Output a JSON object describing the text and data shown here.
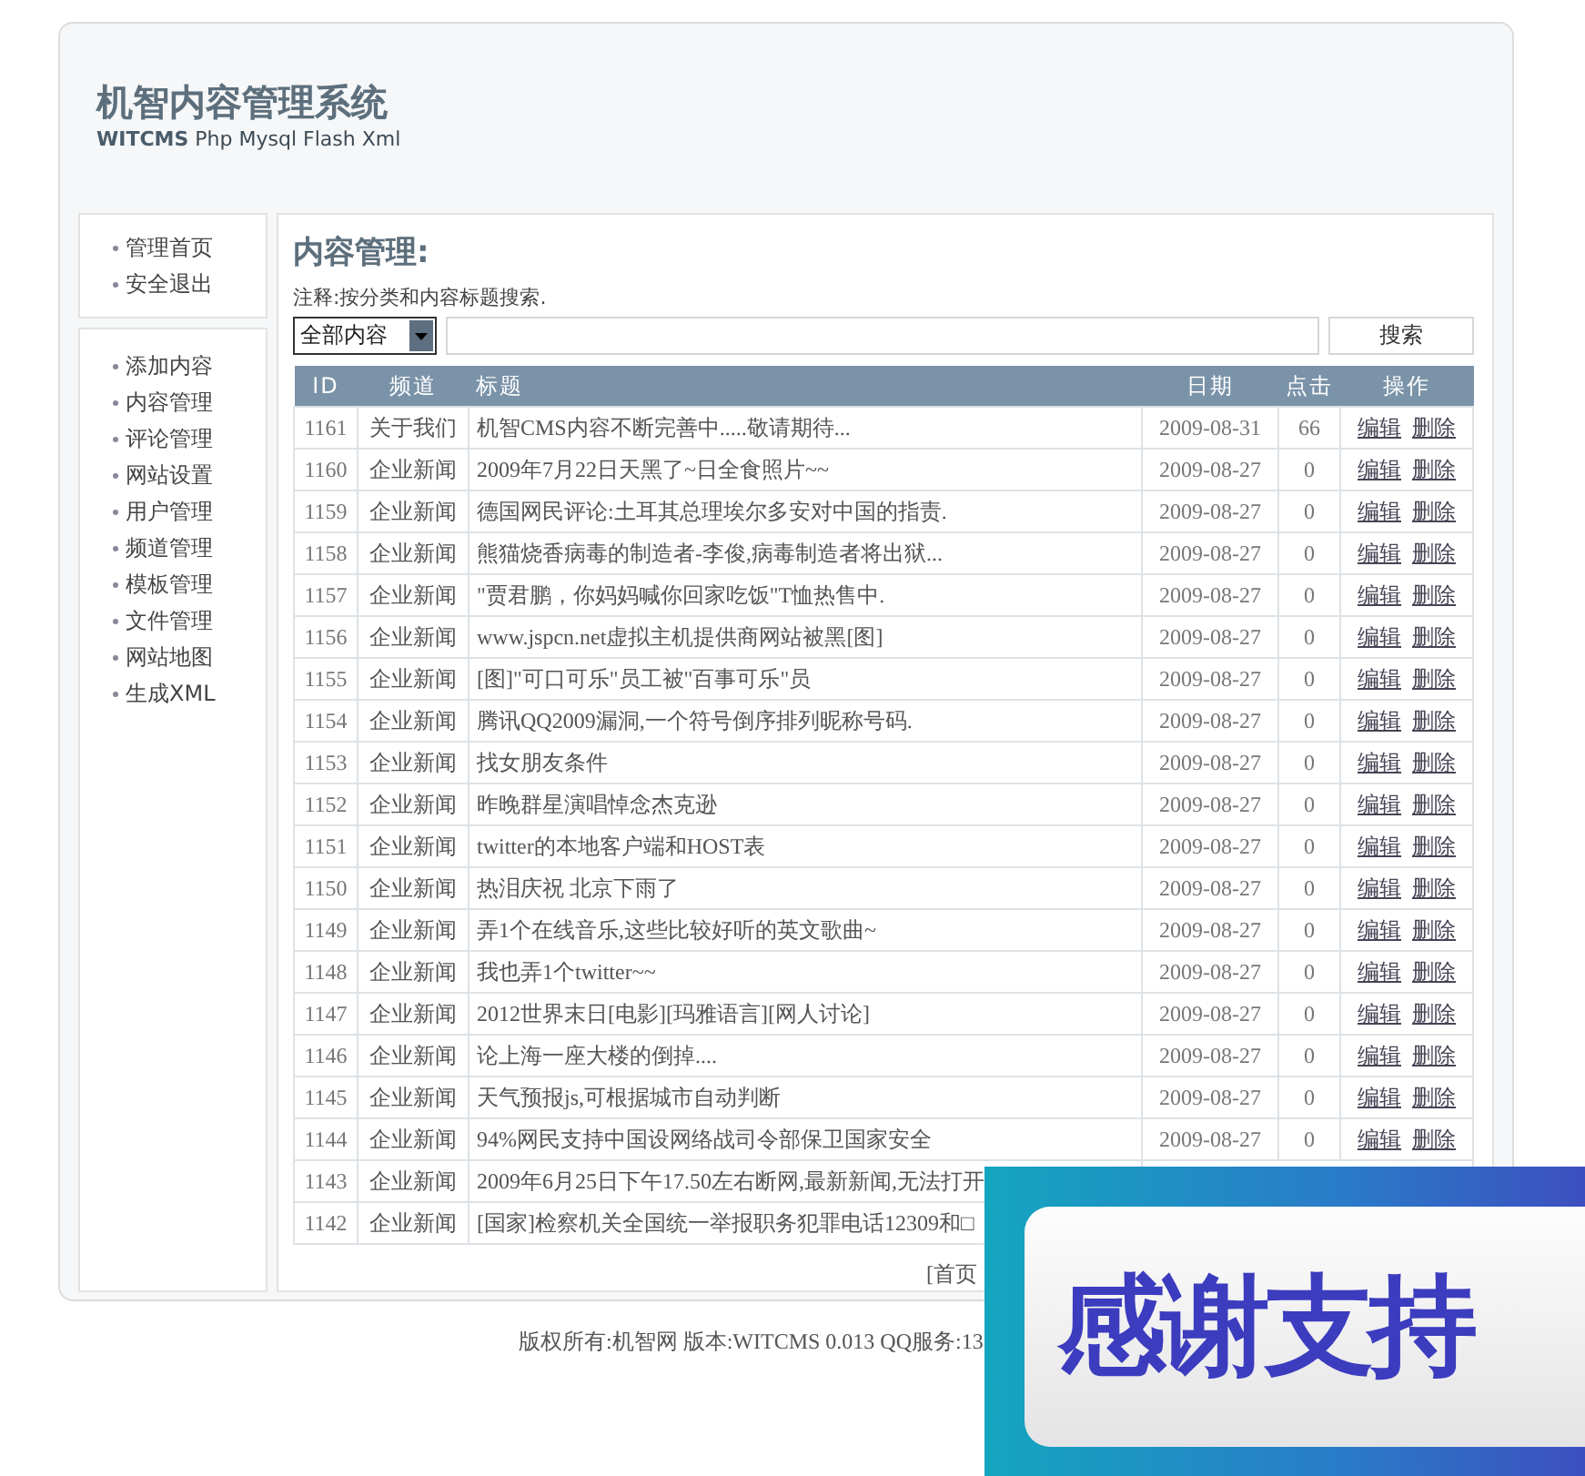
{
  "header": {
    "title": "机智内容管理系统",
    "brand": "WITCMS",
    "subtitle": "Php Mysql Flash Xml"
  },
  "sidebar": {
    "groups": [
      {
        "items": [
          {
            "label": "管理首页"
          },
          {
            "label": "安全退出"
          }
        ]
      },
      {
        "items": [
          {
            "label": "添加内容"
          },
          {
            "label": "内容管理"
          },
          {
            "label": "评论管理"
          },
          {
            "label": "网站设置"
          },
          {
            "label": "用户管理"
          },
          {
            "label": "频道管理"
          },
          {
            "label": "模板管理"
          },
          {
            "label": "文件管理"
          },
          {
            "label": "网站地图"
          },
          {
            "label": "生成XML"
          }
        ]
      }
    ]
  },
  "main": {
    "heading": "内容管理:",
    "note": "注释:按分类和内容标题搜索.",
    "search": {
      "category": "全部内容",
      "button": "搜索"
    },
    "table": {
      "columns": [
        "ID",
        "频道",
        "标题",
        "日期",
        "点击",
        "操作"
      ],
      "rows": [
        {
          "id": "1161",
          "channel": "关于我们",
          "title": "机智CMS内容不断完善中.....敬请期待...",
          "date": "2009-08-31",
          "hits": "66",
          "actions": [
            "编辑",
            "删除"
          ]
        },
        {
          "id": "1160",
          "channel": "企业新闻",
          "title": "2009年7月22日天黑了~日全食照片~~",
          "date": "2009-08-27",
          "hits": "0",
          "actions": [
            "编辑",
            "删除"
          ]
        },
        {
          "id": "1159",
          "channel": "企业新闻",
          "title": "德国网民评论:土耳其总理埃尔多安对中国的指责.",
          "date": "2009-08-27",
          "hits": "0",
          "actions": [
            "编辑",
            "删除"
          ]
        },
        {
          "id": "1158",
          "channel": "企业新闻",
          "title": "熊猫烧香病毒的制造者-李俊,病毒制造者将出狱...",
          "date": "2009-08-27",
          "hits": "0",
          "actions": [
            "编辑",
            "删除"
          ]
        },
        {
          "id": "1157",
          "channel": "企业新闻",
          "title": "\"贾君鹏，你妈妈喊你回家吃饭\"T恤热售中.",
          "date": "2009-08-27",
          "hits": "0",
          "actions": [
            "编辑",
            "删除"
          ]
        },
        {
          "id": "1156",
          "channel": "企业新闻",
          "title": "www.jspcn.net虚拟主机提供商网站被黑[图]",
          "date": "2009-08-27",
          "hits": "0",
          "actions": [
            "编辑",
            "删除"
          ]
        },
        {
          "id": "1155",
          "channel": "企业新闻",
          "title": "[图]\"可口可乐\"员工被\"百事可乐\"员",
          "date": "2009-08-27",
          "hits": "0",
          "actions": [
            "编辑",
            "删除"
          ]
        },
        {
          "id": "1154",
          "channel": "企业新闻",
          "title": "腾讯QQ2009漏洞,一个符号倒序排列昵称号码.",
          "date": "2009-08-27",
          "hits": "0",
          "actions": [
            "编辑",
            "删除"
          ]
        },
        {
          "id": "1153",
          "channel": "企业新闻",
          "title": "找女朋友条件",
          "date": "2009-08-27",
          "hits": "0",
          "actions": [
            "编辑",
            "删除"
          ]
        },
        {
          "id": "1152",
          "channel": "企业新闻",
          "title": "昨晚群星演唱悼念杰克逊",
          "date": "2009-08-27",
          "hits": "0",
          "actions": [
            "编辑",
            "删除"
          ]
        },
        {
          "id": "1151",
          "channel": "企业新闻",
          "title": "twitter的本地客户端和HOST表",
          "date": "2009-08-27",
          "hits": "0",
          "actions": [
            "编辑",
            "删除"
          ]
        },
        {
          "id": "1150",
          "channel": "企业新闻",
          "title": "热泪庆祝  北京下雨了",
          "date": "2009-08-27",
          "hits": "0",
          "actions": [
            "编辑",
            "删除"
          ]
        },
        {
          "id": "1149",
          "channel": "企业新闻",
          "title": "弄1个在线音乐,这些比较好听的英文歌曲~",
          "date": "2009-08-27",
          "hits": "0",
          "actions": [
            "编辑",
            "删除"
          ]
        },
        {
          "id": "1148",
          "channel": "企业新闻",
          "title": "我也弄1个twitter~~",
          "date": "2009-08-27",
          "hits": "0",
          "actions": [
            "编辑",
            "删除"
          ]
        },
        {
          "id": "1147",
          "channel": "企业新闻",
          "title": "2012世界末日[电影][玛雅语言][网人讨论]",
          "date": "2009-08-27",
          "hits": "0",
          "actions": [
            "编辑",
            "删除"
          ]
        },
        {
          "id": "1146",
          "channel": "企业新闻",
          "title": "论上海一座大楼的倒掉....",
          "date": "2009-08-27",
          "hits": "0",
          "actions": [
            "编辑",
            "删除"
          ]
        },
        {
          "id": "1145",
          "channel": "企业新闻",
          "title": "天气预报js,可根据城市自动判断",
          "date": "2009-08-27",
          "hits": "0",
          "actions": [
            "编辑",
            "删除"
          ]
        },
        {
          "id": "1144",
          "channel": "企业新闻",
          "title": "94%网民支持中国设网络战司令部保卫国家安全",
          "date": "2009-08-27",
          "hits": "0",
          "actions": [
            "编辑",
            "删除"
          ]
        },
        {
          "id": "1143",
          "channel": "企业新闻",
          "title": "2009年6月25日下午17.50左右断网,最新新闻,无法打开"
        },
        {
          "id": "1142",
          "channel": "企业新闻",
          "title": "[国家]检察机关全国统一举报职务犯罪电话12309和□"
        }
      ]
    },
    "pagination": "[首页"
  },
  "footer": "版权所有:机智网  版本:WITCMS 0.013 QQ服务:13",
  "overlay_banner": {
    "text": "感谢支持"
  }
}
